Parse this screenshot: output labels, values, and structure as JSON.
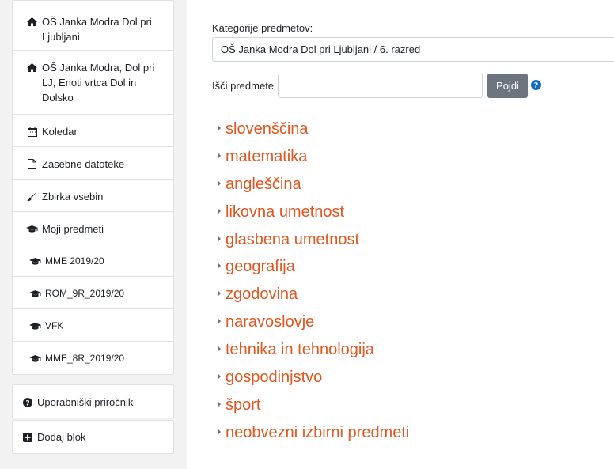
{
  "sidebar": {
    "items": [
      {
        "label": "OŠ Janka Modra Dol pri Ljubljani",
        "icon": "home-icon"
      },
      {
        "label": "OŠ Janka Modra, Dol pri LJ, Enoti vrtca Dol in Dolsko",
        "icon": "home-icon"
      },
      {
        "label": "Koledar",
        "icon": "calendar-icon"
      },
      {
        "label": "Zasebne datoteke",
        "icon": "file-icon"
      },
      {
        "label": "Zbirka vsebin",
        "icon": "brush-icon"
      },
      {
        "label": "Moji predmeti",
        "icon": "graduation-cap-icon"
      },
      {
        "label": "MME 2019/20",
        "icon": "graduation-cap-icon"
      },
      {
        "label": "ROM_9R_2019/20",
        "icon": "graduation-cap-icon"
      },
      {
        "label": "VFK",
        "icon": "graduation-cap-icon"
      },
      {
        "label": "MME_8R_2019/20",
        "icon": "graduation-cap-icon"
      }
    ],
    "guide_label": "Uporabniški priročnik",
    "add_block_label": "Dodaj blok"
  },
  "main": {
    "category_label": "Kategorije predmetov:",
    "category_value": "OŠ Janka Modra Dol pri Ljubljani / 6. razred",
    "search_label": "Išči predmete",
    "search_value": "",
    "search_button": "Pojdi",
    "subjects": [
      "slovenščina",
      "matematika",
      "angleščina",
      "likovna umetnost",
      "glasbena umetnost",
      "geografija",
      "zgodovina",
      "naravoslovje",
      "tehnika in tehnologija",
      "gospodinjstvo",
      "šport",
      "neobvezni izbirni predmeti"
    ]
  },
  "colors": {
    "link": "#e4561f",
    "button": "#6c757d",
    "help": "#0f6cbf",
    "drawer_bg": "#f2f2f2"
  }
}
